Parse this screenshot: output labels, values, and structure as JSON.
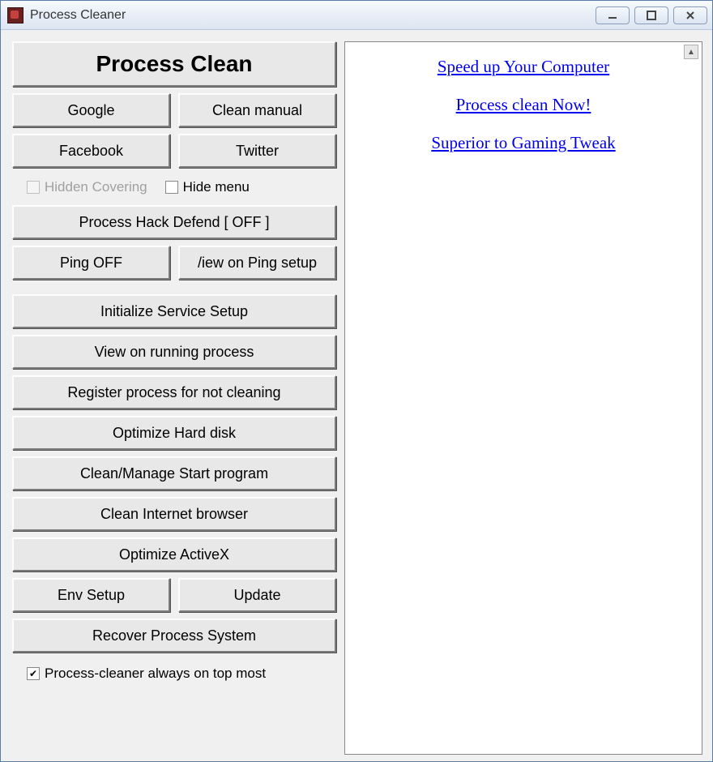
{
  "window": {
    "title": "Process Cleaner"
  },
  "left": {
    "main_button": "Process Clean",
    "row1": {
      "google": "Google",
      "clean_manual": "Clean manual"
    },
    "row2": {
      "facebook": "Facebook",
      "twitter": "Twitter"
    },
    "checks": {
      "hidden_covering": "Hidden Covering",
      "hide_menu": "Hide menu"
    },
    "process_hack_defend": "Process Hack Defend [ OFF ]",
    "row_ping": {
      "ping_off": "Ping OFF",
      "view_ping_setup": "/iew on Ping setup"
    },
    "initialize_service": "Initialize Service Setup",
    "view_running": "View on running process",
    "register_exclude": "Register process for not cleaning",
    "optimize_hd": "Optimize Hard disk",
    "clean_start": "Clean/Manage Start program",
    "clean_browser": "Clean Internet browser",
    "optimize_activex": "Optimize ActiveX",
    "row_env": {
      "env_setup": "Env Setup",
      "update": "Update"
    },
    "recover": "Recover Process System",
    "always_top": "Process-cleaner always on top most"
  },
  "right": {
    "links": [
      "Speed up Your Computer",
      "Process clean Now!",
      "Superior to Gaming Tweak"
    ]
  }
}
